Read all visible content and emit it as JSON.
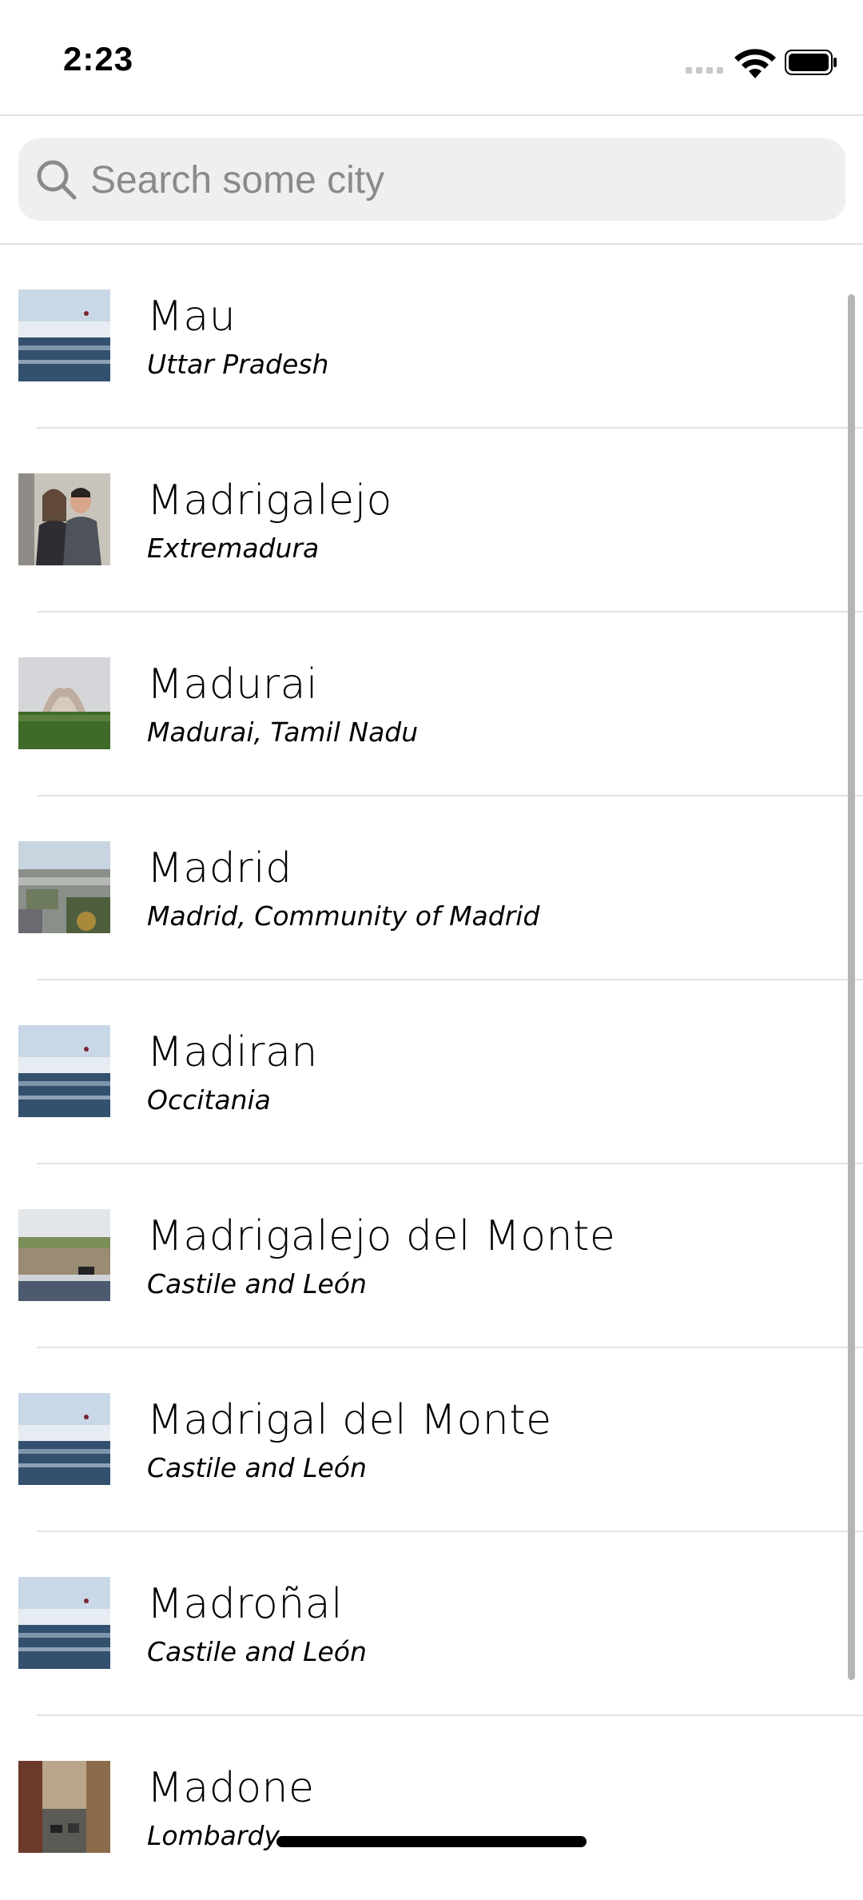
{
  "status_bar": {
    "time": "2:23",
    "icons": [
      "cellular-signal-icon",
      "wifi-icon",
      "battery-icon"
    ]
  },
  "search": {
    "placeholder": "Search some city",
    "value": ""
  },
  "cities": [
    {
      "name": "Mau",
      "region": "Uttar Pradesh",
      "thumb": "sea"
    },
    {
      "name": "Madrigalejo",
      "region": "Extremadura",
      "thumb": "people"
    },
    {
      "name": "Madurai",
      "region": "Madurai, Tamil Nadu",
      "thumb": "temple"
    },
    {
      "name": "Madrid",
      "region": "Madrid, Community of Madrid",
      "thumb": "cityscape"
    },
    {
      "name": "Madiran",
      "region": "Occitania",
      "thumb": "sea"
    },
    {
      "name": "Madrigalejo del Monte",
      "region": "Castile and León",
      "thumb": "field"
    },
    {
      "name": "Madrigal del Monte",
      "region": "Castile and León",
      "thumb": "sea"
    },
    {
      "name": "Madroñal",
      "region": "Castile and León",
      "thumb": "sea"
    },
    {
      "name": "Madone",
      "region": "Lombardy",
      "thumb": "street"
    }
  ]
}
